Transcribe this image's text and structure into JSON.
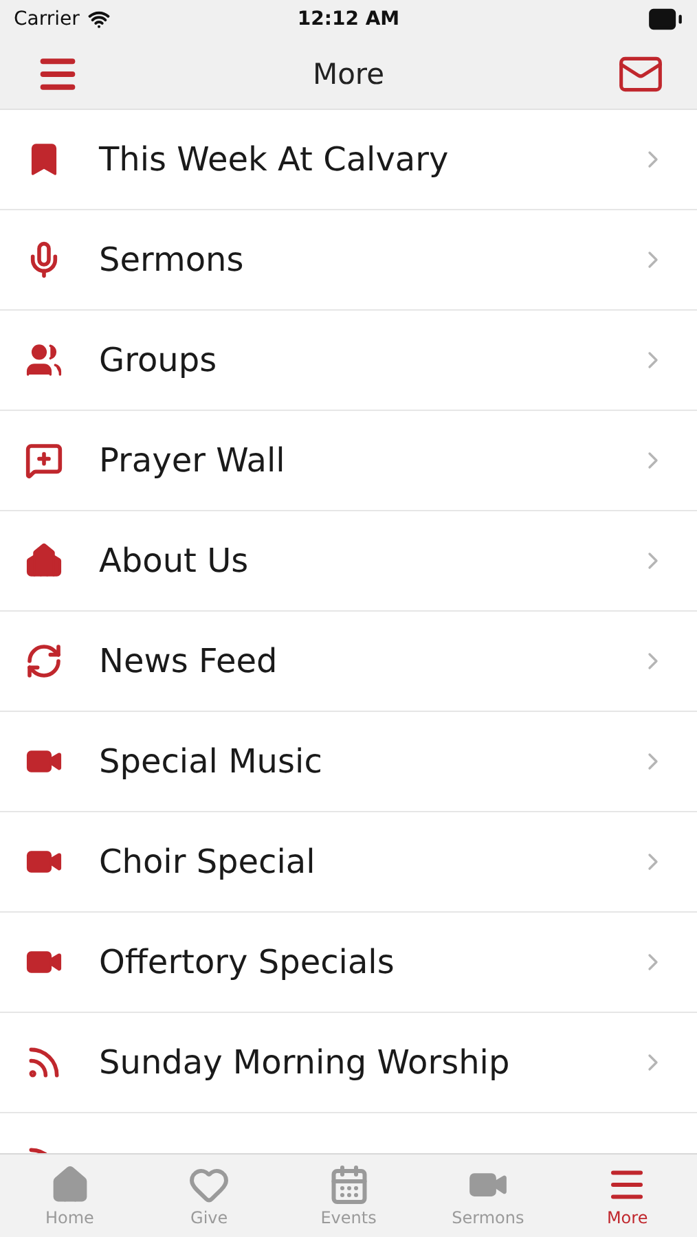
{
  "status_bar": {
    "carrier": "Carrier",
    "time": "12:12 AM"
  },
  "nav_bar": {
    "title": "More"
  },
  "menu": [
    {
      "label": "This Week At Calvary",
      "kind": "bookmark"
    },
    {
      "label": "Sermons",
      "kind": "microphone"
    },
    {
      "label": "Groups",
      "kind": "people"
    },
    {
      "label": "Prayer Wall",
      "kind": "speech"
    },
    {
      "label": "About Us",
      "kind": "chapel"
    },
    {
      "label": "News Feed",
      "kind": "refresh"
    },
    {
      "label": "Special Music",
      "kind": "video"
    },
    {
      "label": "Choir Special",
      "kind": "video"
    },
    {
      "label": "Offertory Specials",
      "kind": "video"
    },
    {
      "label": "Sunday Morning Worship",
      "kind": "feed"
    },
    {
      "kind": "feed"
    }
  ],
  "tab_bar": [
    {
      "label": "Home",
      "kind": "home",
      "selected": false
    },
    {
      "label": "Give",
      "kind": "heart",
      "selected": false
    },
    {
      "label": "Events",
      "kind": "calendar",
      "selected": false
    },
    {
      "label": "Sermons",
      "kind": "video",
      "selected": false
    },
    {
      "label": "More",
      "kind": "menu",
      "selected": true
    }
  ]
}
